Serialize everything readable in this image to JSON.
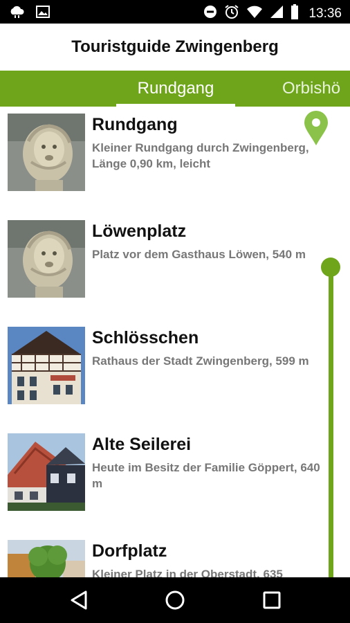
{
  "status_bar": {
    "time": "13:36",
    "left_icons": [
      "weather-cloud-icon",
      "image-icon"
    ],
    "right_icons": [
      "do-not-disturb-icon",
      "alarm-icon",
      "wifi-icon",
      "signal-icon",
      "battery-icon"
    ]
  },
  "app": {
    "title": "Touristguide Zwingenberg",
    "accent_color": "#6ea51b"
  },
  "tabs": [
    {
      "label": "Rundgang",
      "active": true
    },
    {
      "label": "Orbishö",
      "active": false
    }
  ],
  "stops": [
    {
      "title": "Rundgang",
      "description": "Kleiner Rundgang durch Zwingenberg, Länge 0,90 km, leicht",
      "image": "lion-statue"
    },
    {
      "title": "Löwenplatz",
      "description": "Platz vor dem Gasthaus Löwen, 540 m",
      "image": "lion-statue"
    },
    {
      "title": "Schlösschen",
      "description": "Rathaus der Stadt Zwingenberg, 599 m",
      "image": "town-hall"
    },
    {
      "title": "Alte Seilerei",
      "description": "Heute im Besitz der Familie Göppert, 640 m",
      "image": "half-timbered-house"
    },
    {
      "title": "Dorfplatz",
      "description": "Kleiner Platz in der Oberstadt, 635",
      "image": "village-square"
    }
  ],
  "nav": {
    "buttons": [
      "back-icon",
      "home-icon",
      "recents-icon"
    ]
  }
}
